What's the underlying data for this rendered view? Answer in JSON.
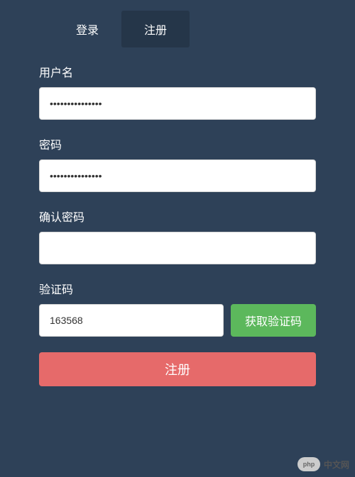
{
  "tabs": {
    "login": "登录",
    "register": "注册"
  },
  "form": {
    "username": {
      "label": "用户名",
      "value": "•••••••••••••••"
    },
    "password": {
      "label": "密码",
      "value": "•••••••••••••••"
    },
    "confirm_password": {
      "label": "确认密码",
      "value": ""
    },
    "captcha": {
      "label": "验证码",
      "value": "163568",
      "button": "获取验证码"
    },
    "submit": "注册"
  },
  "watermark": {
    "logo": "php",
    "text": "中文网"
  }
}
